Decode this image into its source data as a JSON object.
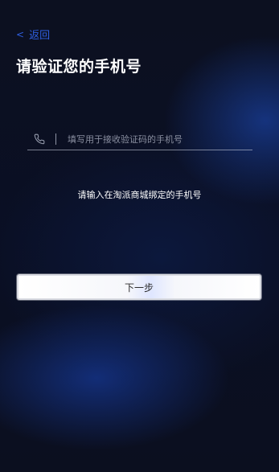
{
  "header": {
    "back_label": "返回",
    "title": "请验证您的手机号"
  },
  "form": {
    "phone_placeholder": "填写用于接收验证码的手机号",
    "phone_value": "",
    "hint": "请输入在淘派商城绑定的手机号",
    "next_button_label": "下一步"
  },
  "icons": {
    "back": "chevron-left-icon",
    "phone": "phone-icon"
  },
  "colors": {
    "background": "#0a0e1e",
    "accent_link": "#2f5fe0",
    "title_text": "#ffffff",
    "button_bg": "#ffffff",
    "button_text": "#2c2c2c"
  }
}
